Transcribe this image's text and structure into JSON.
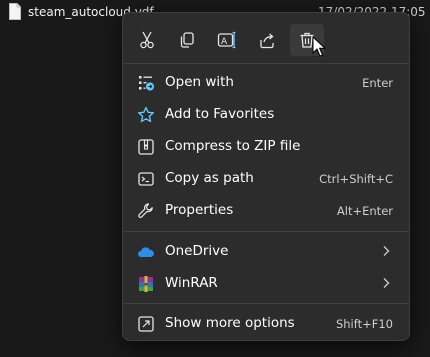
{
  "file": {
    "name": "steam_autocloud.vdf",
    "date": "17/02/2022 17:05"
  },
  "toolbar": {
    "buttons": [
      {
        "icon": "scissors-icon",
        "name": "cut"
      },
      {
        "icon": "copy-icon",
        "name": "copy"
      },
      {
        "icon": "rename-icon",
        "name": "rename"
      },
      {
        "icon": "share-icon",
        "name": "share"
      },
      {
        "icon": "trash-icon",
        "name": "delete"
      }
    ]
  },
  "menu": {
    "items": [
      {
        "label": "Open with",
        "shortcut": "Enter",
        "icon": "open-with-icon"
      },
      {
        "label": "Add to Favorites",
        "shortcut": "",
        "icon": "star-icon"
      },
      {
        "label": "Compress to ZIP file",
        "shortcut": "",
        "icon": "zip-icon"
      },
      {
        "label": "Copy as path",
        "shortcut": "Ctrl+Shift+C",
        "icon": "copy-path-icon"
      },
      {
        "label": "Properties",
        "shortcut": "Alt+Enter",
        "icon": "wrench-icon"
      },
      {
        "label": "OneDrive",
        "shortcut": "",
        "icon": "onedrive-icon",
        "submenu": true
      },
      {
        "label": "WinRAR",
        "shortcut": "",
        "icon": "winrar-icon",
        "submenu": true
      },
      {
        "label": "Show more options",
        "shortcut": "Shift+F10",
        "icon": "show-more-icon"
      }
    ]
  },
  "colors": {
    "background": "#191919",
    "menu_bg": "#2c2c2c",
    "accent_blue": "#60cdff",
    "onedrive_blue": "#2f8fe8"
  }
}
